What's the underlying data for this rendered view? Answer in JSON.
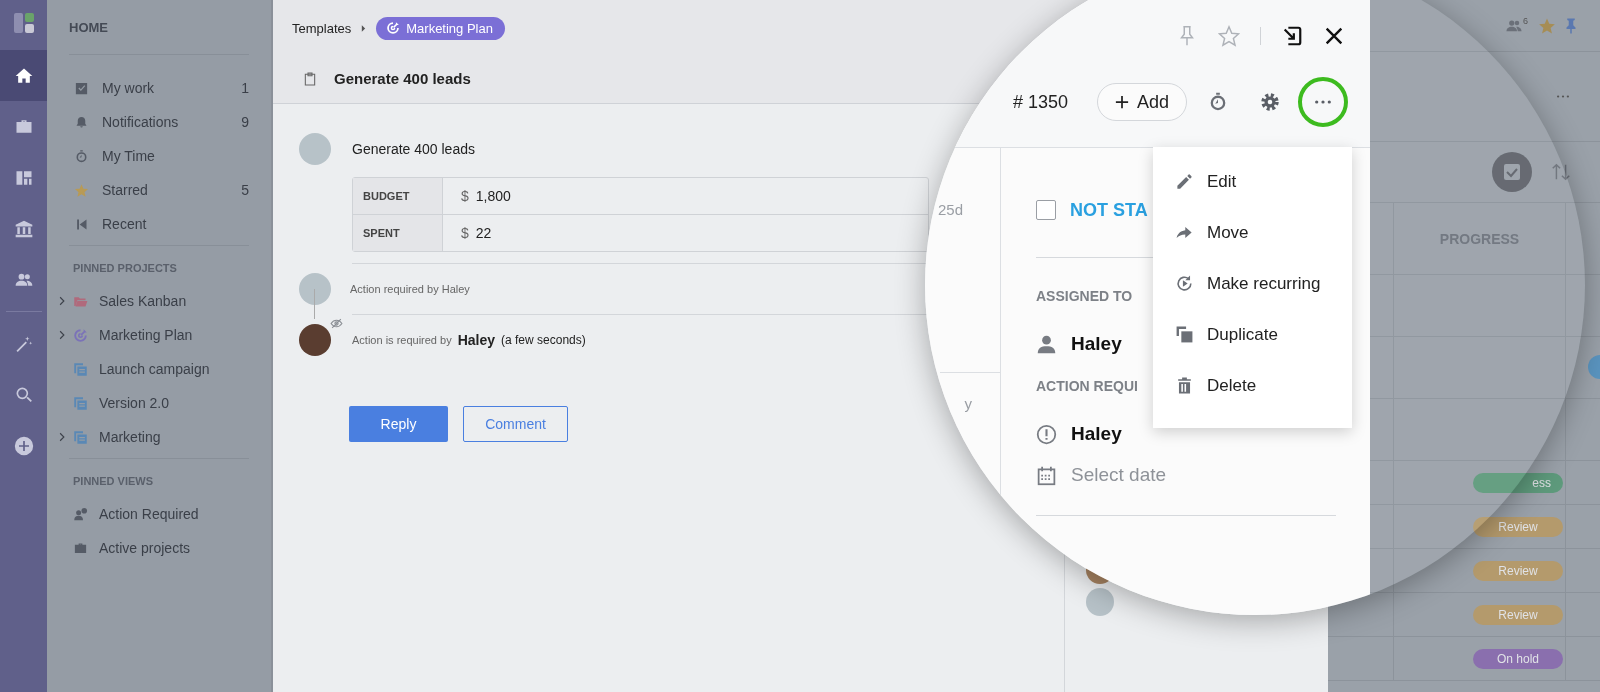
{
  "rail": {
    "items": [
      {
        "kind": "home",
        "selected": true
      },
      {
        "kind": "briefcase",
        "selected": false
      },
      {
        "kind": "board",
        "selected": false
      },
      {
        "kind": "bank",
        "selected": false
      },
      {
        "kind": "people",
        "selected": false
      },
      {
        "kind": "wand",
        "selected": false
      },
      {
        "kind": "search",
        "selected": false
      },
      {
        "kind": "plus",
        "selected": false
      }
    ]
  },
  "sidebar": {
    "title": "HOME",
    "items": [
      {
        "kind": "checkbox",
        "label": "My work",
        "count": "1"
      },
      {
        "kind": "bell",
        "label": "Notifications",
        "count": "9"
      },
      {
        "kind": "stopwatch",
        "label": "My Time"
      },
      {
        "kind": "star",
        "label": "Starred",
        "count": "5"
      },
      {
        "kind": "skip-back",
        "label": "Recent"
      }
    ],
    "pinned_projects": {
      "title": "PINNED PROJECTS",
      "items": [
        {
          "kind": "folder",
          "label": "Sales Kanban",
          "expandable": true
        },
        {
          "kind": "target",
          "label": "Marketing Plan",
          "expandable": true
        },
        {
          "kind": "stack",
          "label": "Launch campaign",
          "expandable": false
        },
        {
          "kind": "stack",
          "label": "Version 2.0",
          "expandable": false
        },
        {
          "kind": "stack",
          "label": "Marketing",
          "expandable": true
        }
      ]
    },
    "pinned_views": {
      "title": "PINNED VIEWS",
      "items": [
        {
          "kind": "person-alert",
          "label": "Action Required"
        },
        {
          "kind": "briefcase",
          "label": "Active projects"
        }
      ]
    }
  },
  "task": {
    "breadcrumb": {
      "parent": "Templates",
      "project": "Marketing Plan"
    },
    "title": "Generate 400 leads",
    "entry": {
      "text": "Generate 400 leads",
      "fields": [
        {
          "label": "BUDGET",
          "currency": "$",
          "value": "1,800"
        },
        {
          "label": "SPENT",
          "currency": "$",
          "value": "22"
        }
      ]
    },
    "activity": [
      {
        "kind": "note",
        "text": "Action required by Haley"
      },
      {
        "kind": "mention",
        "prefix": "Action is required by",
        "person": "Haley",
        "time": "(a few seconds)"
      }
    ],
    "buttons": [
      {
        "kind": "primary",
        "label": "Reply"
      },
      {
        "kind": "outline",
        "label": "Comment"
      }
    ]
  },
  "details": {
    "number": "# 1350",
    "add_label": "Add",
    "more_highlighted": true,
    "side_texts": [
      "25d",
      "y"
    ],
    "status": {
      "label": "NOT STA",
      "checked": false
    },
    "assigned_title": "ASSIGNED TO",
    "assignee": "Haley",
    "action_title": "ACTION REQUI",
    "action_person": "Haley",
    "date": {
      "placeholder": "Select date"
    }
  },
  "menu": [
    {
      "kind": "pencil",
      "label": "Edit"
    },
    {
      "kind": "arrow",
      "label": "Move"
    },
    {
      "kind": "recurring",
      "label": "Make recurring"
    },
    {
      "kind": "duplicate",
      "label": "Duplicate"
    },
    {
      "kind": "trash",
      "label": "Delete"
    }
  ],
  "board": {
    "members_count": "6",
    "column": "PROGRESS",
    "pills": [
      {
        "label": "ess",
        "color": "#5e9a7c"
      },
      {
        "label": "Review",
        "color": "#b49a6c"
      },
      {
        "label": "Review",
        "color": "#b49a6c"
      },
      {
        "label": "Review",
        "color": "#b49a6c"
      },
      {
        "label": "On hold",
        "color": "#8a6fae"
      }
    ]
  }
}
